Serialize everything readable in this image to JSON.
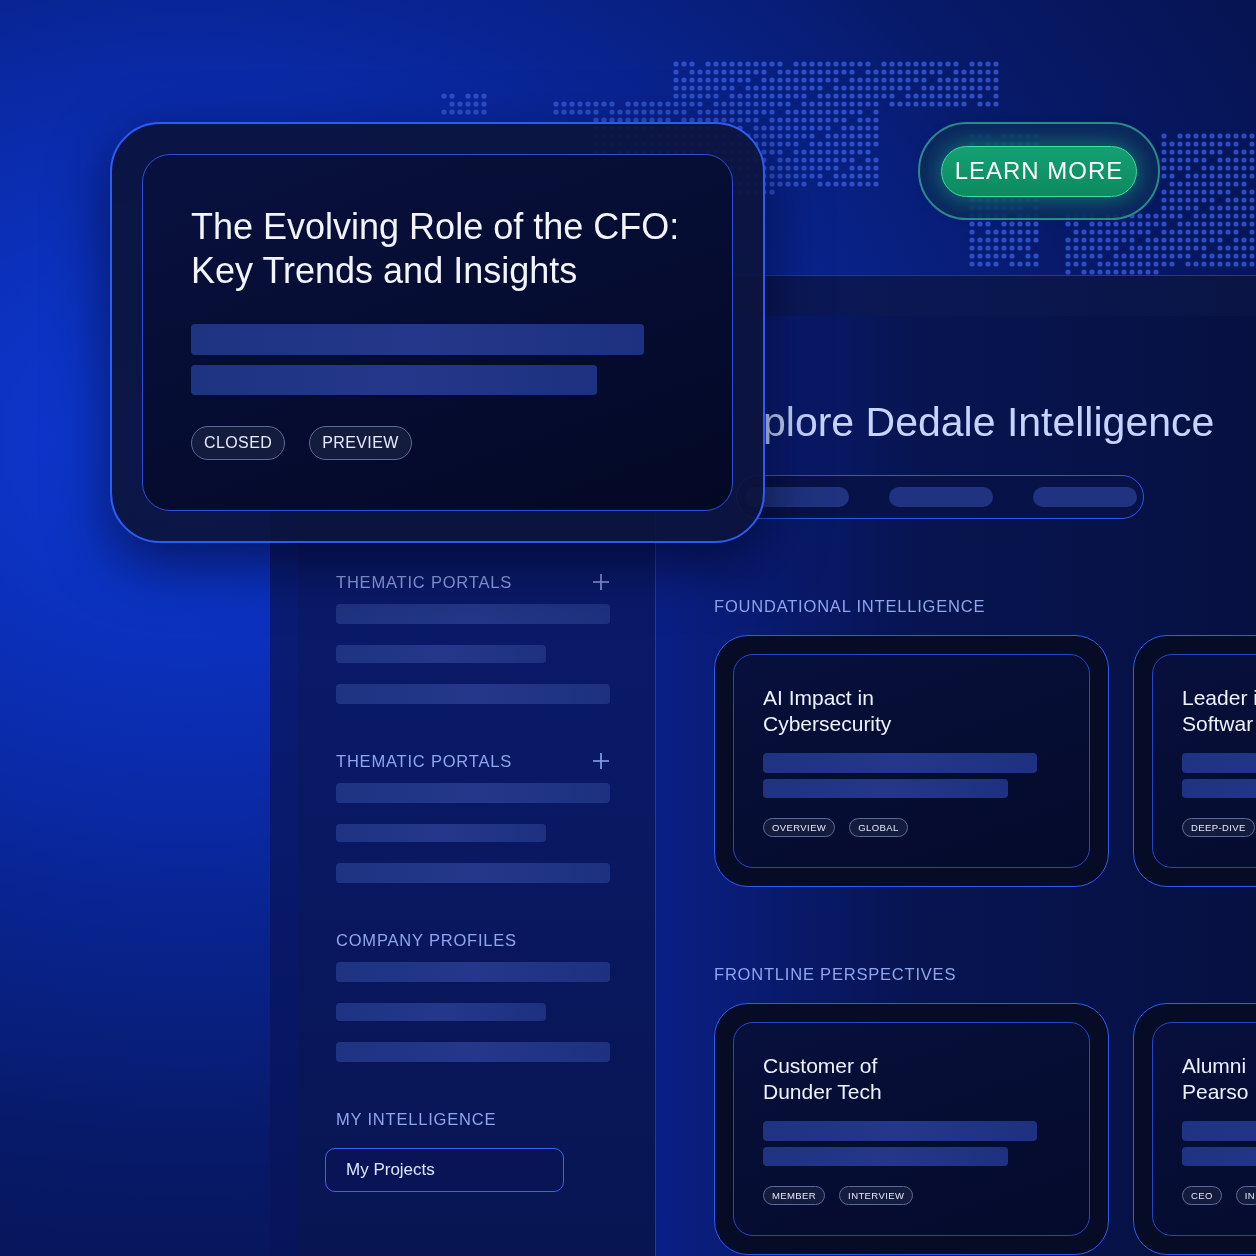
{
  "promo_card": {
    "title_lines": [
      "The Evolving Role of the CFO:",
      "Key Trends and Insights"
    ],
    "tags": [
      "CLOSED",
      "PREVIEW"
    ]
  },
  "learn_more_button": "LEARN MORE",
  "sidebar": {
    "sections": [
      {
        "heading": "THEMATIC PORTALS",
        "expandable": true
      },
      {
        "heading": "THEMATIC PORTALS",
        "expandable": true
      },
      {
        "heading": "COMPANY PROFILES",
        "expandable": false
      },
      {
        "heading": "MY INTELLIGENCE",
        "expandable": false,
        "button": "My Projects"
      }
    ]
  },
  "main": {
    "heading": "plore Dedale Intelligence",
    "sections": [
      {
        "heading": "FOUNDATIONAL INTELLIGENCE",
        "cards": [
          {
            "title_lines": [
              "AI Impact in",
              "Cybersecurity"
            ],
            "tags": [
              "OVERVIEW",
              "GLOBAL"
            ]
          },
          {
            "title_lines": [
              "Leader i",
              "Softwar"
            ],
            "tags": [
              "DEEP-DIVE"
            ]
          }
        ]
      },
      {
        "heading": "FRONTLINE PERSPECTIVES",
        "cards": [
          {
            "title_lines": [
              "Customer of",
              "Dunder Tech"
            ],
            "tags": [
              "MEMBER",
              "INTERVIEW"
            ]
          },
          {
            "title_lines": [
              "Alumni",
              "Pearso"
            ],
            "tags": [
              "CEO",
              "IN"
            ]
          }
        ]
      }
    ]
  }
}
